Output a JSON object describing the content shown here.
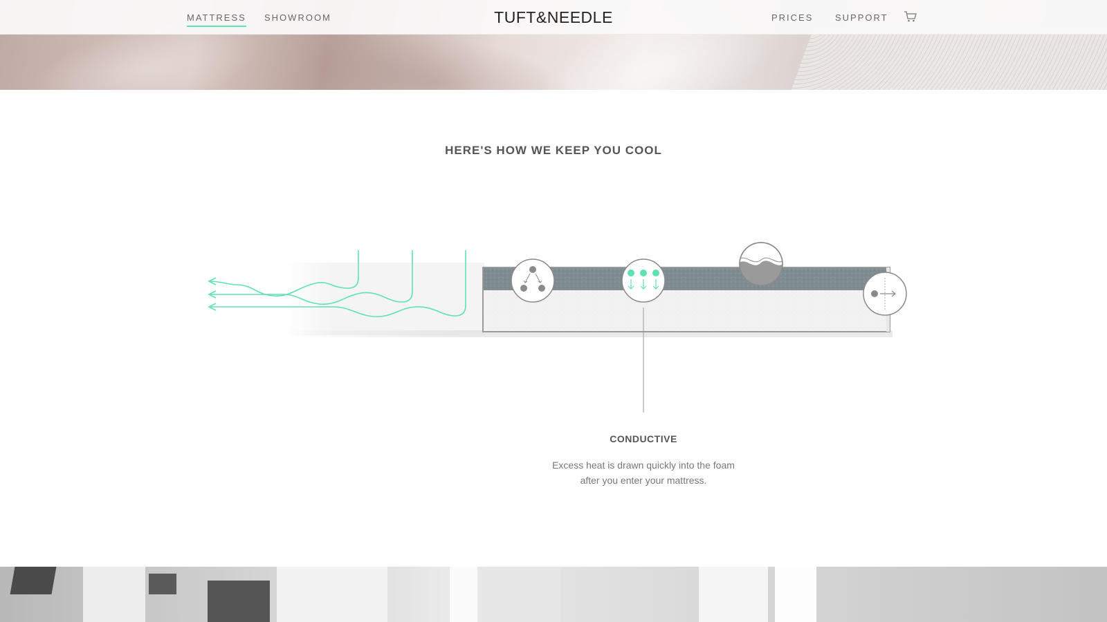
{
  "header": {
    "nav_left": [
      {
        "label": "MATTRESS",
        "active": true
      },
      {
        "label": "SHOWROOM",
        "active": false
      }
    ],
    "logo": "TUFT&NEEDLE",
    "nav_right": [
      {
        "label": "PRICES"
      },
      {
        "label": "SUPPORT"
      }
    ],
    "cart_icon": "cart-icon"
  },
  "section": {
    "title": "HERE'S HOW WE KEEP YOU COOL",
    "feature": {
      "title": "CONDUCTIVE",
      "description_line1": "Excess heat is drawn quickly into the foam",
      "description_line2": "after you enter your mattress."
    }
  },
  "diagram": {
    "icons": [
      "network-icon",
      "heat-down-arrows-icon",
      "wave-icon",
      "horizontal-flow-icon"
    ],
    "accent_color": "#5ee2b0",
    "top_layer_color": "#7f8d92",
    "bottom_layer_color": "#f2f2f2"
  }
}
